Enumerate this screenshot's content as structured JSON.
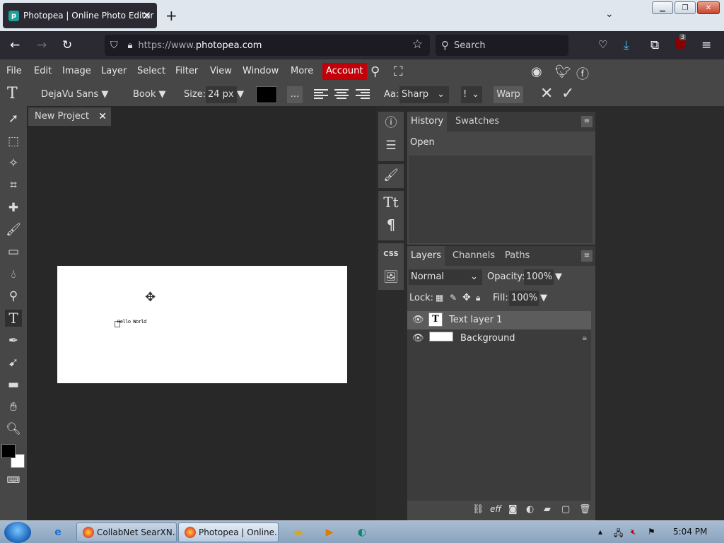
{
  "browser": {
    "tab_title": "Photopea | Online Photo Editor",
    "url_scheme": "https://www.",
    "url_host": "photopea.com",
    "search_placeholder": "Search",
    "extension_badge": "3"
  },
  "menu": {
    "items": [
      "File",
      "Edit",
      "Image",
      "Layer",
      "Select",
      "Filter",
      "View",
      "Window",
      "More"
    ],
    "account": "Account"
  },
  "options": {
    "font_family": "DejaVu Sans",
    "font_style": "Book",
    "size_label": "Size:",
    "size_value": "24 px",
    "more": "...",
    "aa_label": "Aa:",
    "aa_value": "Sharp",
    "small_value": "!",
    "warp": "Warp",
    "text_color": "#000000"
  },
  "document": {
    "tab_name": "New Project",
    "canvas_text": "Hello World"
  },
  "history": {
    "tabs": [
      "History",
      "Swatches"
    ],
    "entries": [
      "Open"
    ]
  },
  "layers": {
    "tabs": [
      "Layers",
      "Channels",
      "Paths"
    ],
    "blend_mode": "Normal",
    "opacity_label": "Opacity:",
    "opacity_value": "100%",
    "lock_label": "Lock:",
    "fill_label": "Fill:",
    "fill_value": "100%",
    "rows": [
      {
        "name": "Text layer 1",
        "thumb": "T"
      },
      {
        "name": "Background"
      }
    ]
  },
  "taskbar": {
    "buttons": [
      "CollabNet SearXN...",
      "Photopea | Online..."
    ],
    "clock": "5:04 PM"
  },
  "colors": {
    "accent": "#c2000a",
    "panel": "#474747",
    "workspace": "#282828"
  }
}
